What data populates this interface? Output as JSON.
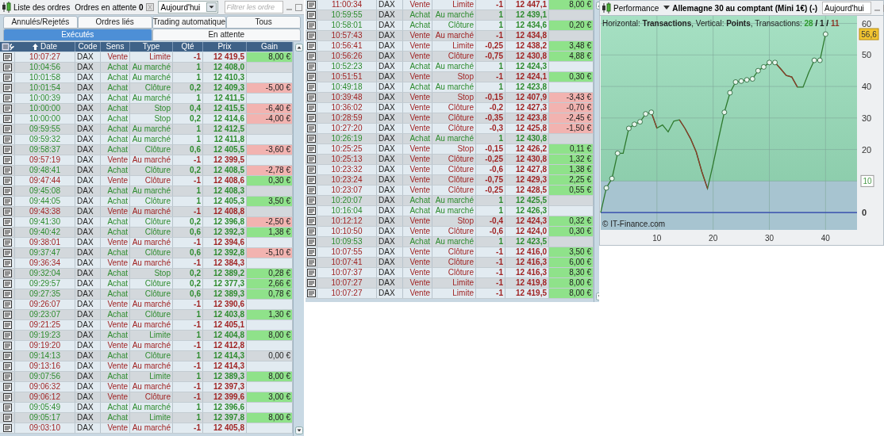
{
  "orders_panel": {
    "title": "Liste des ordres",
    "pending_label": "Ordres en attente",
    "pending_count": "0",
    "period": "Aujourd'hui",
    "filter": {
      "placeholder": "Filtrer les ordre"
    },
    "tabs_top": [
      {
        "label": "Annulés/Rejetés",
        "selected": false
      },
      {
        "label": "Ordres liés",
        "selected": false
      },
      {
        "label": "Trading automatique",
        "selected": false
      },
      {
        "label": "Tous",
        "selected": false
      }
    ],
    "tabs_bottom": [
      {
        "label": "Exécutés",
        "selected": true
      },
      {
        "label": "En attente",
        "selected": false
      }
    ],
    "columns": [
      "Date",
      "Code",
      "Sens",
      "Type",
      "Qté",
      "Prix",
      "Gain"
    ],
    "rows": [
      {
        "time": "10:07:27",
        "code": "DAX",
        "sens": "Vente",
        "type": "Limite",
        "qty": "-1",
        "price": "12 419,5",
        "gain": {
          "text": "8,00 €",
          "color": "#8fe28a"
        },
        "kind": "sell"
      },
      {
        "time": "10:04:56",
        "code": "DAX",
        "sens": "Achat",
        "type": "Au marché",
        "qty": "1",
        "price": "12 408,0",
        "kind": "buy"
      },
      {
        "time": "10:01:58",
        "code": "DAX",
        "sens": "Achat",
        "type": "Au marché",
        "qty": "1",
        "price": "12 410,3",
        "kind": "buy"
      },
      {
        "time": "10:01:54",
        "code": "DAX",
        "sens": "Achat",
        "type": "Clôture",
        "qty": "0,2",
        "price": "12 409,3",
        "gain": {
          "text": "-5,00 €",
          "color": "#f2b3b0"
        },
        "kind": "buy"
      },
      {
        "time": "10:00:39",
        "code": "DAX",
        "sens": "Achat",
        "type": "Au marché",
        "qty": "1",
        "price": "12 411,5",
        "kind": "buy"
      },
      {
        "time": "10:00:00",
        "code": "DAX",
        "sens": "Achat",
        "type": "Stop",
        "qty": "0,4",
        "price": "12 415,5",
        "gain": {
          "text": "-6,40 €",
          "color": "#f2b3b0"
        },
        "kind": "buy"
      },
      {
        "time": "10:00:00",
        "code": "DAX",
        "sens": "Achat",
        "type": "Stop",
        "qty": "0,2",
        "price": "12 414,6",
        "gain": {
          "text": "-4,00 €",
          "color": "#f2b3b0"
        },
        "kind": "buy"
      },
      {
        "time": "09:59:55",
        "code": "DAX",
        "sens": "Achat",
        "type": "Au marché",
        "qty": "1",
        "price": "12 412,5",
        "kind": "buy"
      },
      {
        "time": "09:59:32",
        "code": "DAX",
        "sens": "Achat",
        "type": "Au marché",
        "qty": "1",
        "price": "12 411,8",
        "kind": "buy"
      },
      {
        "time": "09:58:37",
        "code": "DAX",
        "sens": "Achat",
        "type": "Clôture",
        "qty": "0,6",
        "price": "12 405,5",
        "gain": {
          "text": "-3,60 €",
          "color": "#f2b3b0"
        },
        "kind": "buy"
      },
      {
        "time": "09:57:19",
        "code": "DAX",
        "sens": "Vente",
        "type": "Au marché",
        "qty": "-1",
        "price": "12 399,5",
        "kind": "sell"
      },
      {
        "time": "09:48:41",
        "code": "DAX",
        "sens": "Achat",
        "type": "Clôture",
        "qty": "0,2",
        "price": "12 408,5",
        "gain": {
          "text": "-2,78 €",
          "color": "#f2b3b0"
        },
        "kind": "buy"
      },
      {
        "time": "09:47:44",
        "code": "DAX",
        "sens": "Vente",
        "type": "Clôture",
        "qty": "-1",
        "price": "12 408,6",
        "gain": {
          "text": "0,30 €",
          "color": "#8fe28a"
        },
        "kind": "sell"
      },
      {
        "time": "09:45:08",
        "code": "DAX",
        "sens": "Achat",
        "type": "Au marché",
        "qty": "1",
        "price": "12 408,3",
        "kind": "buy"
      },
      {
        "time": "09:44:05",
        "code": "DAX",
        "sens": "Achat",
        "type": "Clôture",
        "qty": "1",
        "price": "12 405,3",
        "gain": {
          "text": "3,50 €",
          "color": "#8fe28a"
        },
        "kind": "buy"
      },
      {
        "time": "09:43:38",
        "code": "DAX",
        "sens": "Vente",
        "type": "Au marché",
        "qty": "-1",
        "price": "12 408,8",
        "kind": "sell"
      },
      {
        "time": "09:41:30",
        "code": "DAX",
        "sens": "Achat",
        "type": "Clôture",
        "qty": "0,2",
        "price": "12 396,8",
        "gain": {
          "text": "-2,50 €",
          "color": "#f2b3b0"
        },
        "kind": "buy"
      },
      {
        "time": "09:40:42",
        "code": "DAX",
        "sens": "Achat",
        "type": "Clôture",
        "qty": "0,6",
        "price": "12 392,3",
        "gain": {
          "text": "1,38 €",
          "color": "#8fe28a"
        },
        "kind": "buy"
      },
      {
        "time": "09:38:01",
        "code": "DAX",
        "sens": "Vente",
        "type": "Au marché",
        "qty": "-1",
        "price": "12 394,6",
        "kind": "sell"
      },
      {
        "time": "09:37:47",
        "code": "DAX",
        "sens": "Achat",
        "type": "Clôture",
        "qty": "0,6",
        "price": "12 392,8",
        "gain": {
          "text": "-5,10 €",
          "color": "#f2b3b0"
        },
        "kind": "buy"
      },
      {
        "time": "09:36:34",
        "code": "DAX",
        "sens": "Vente",
        "type": "Au marché",
        "qty": "-1",
        "price": "12 384,3",
        "kind": "sell"
      },
      {
        "time": "09:32:04",
        "code": "DAX",
        "sens": "Achat",
        "type": "Stop",
        "qty": "0,2",
        "price": "12 389,2",
        "gain": {
          "text": "0,28 €",
          "color": "#8fe28a"
        },
        "kind": "buy"
      },
      {
        "time": "09:29:57",
        "code": "DAX",
        "sens": "Achat",
        "type": "Clôture",
        "qty": "0,2",
        "price": "12 377,3",
        "gain": {
          "text": "2,66 €",
          "color": "#8fe28a"
        },
        "kind": "buy"
      },
      {
        "time": "09:27:35",
        "code": "DAX",
        "sens": "Achat",
        "type": "Clôture",
        "qty": "0,6",
        "price": "12 389,3",
        "gain": {
          "text": "0,78 €",
          "color": "#8fe28a"
        },
        "kind": "buy"
      },
      {
        "time": "09:26:07",
        "code": "DAX",
        "sens": "Vente",
        "type": "Au marché",
        "qty": "-1",
        "price": "12 390,6",
        "kind": "sell"
      },
      {
        "time": "09:23:07",
        "code": "DAX",
        "sens": "Achat",
        "type": "Clôture",
        "qty": "1",
        "price": "12 403,8",
        "gain": {
          "text": "1,30 €",
          "color": "#8fe28a"
        },
        "kind": "buy"
      },
      {
        "time": "09:21:25",
        "code": "DAX",
        "sens": "Vente",
        "type": "Au marché",
        "qty": "-1",
        "price": "12 405,1",
        "kind": "sell"
      },
      {
        "time": "09:19:23",
        "code": "DAX",
        "sens": "Achat",
        "type": "Limite",
        "qty": "1",
        "price": "12 404,8",
        "gain": {
          "text": "8,00 €",
          "color": "#8fe28a"
        },
        "kind": "buy"
      },
      {
        "time": "09:19:20",
        "code": "DAX",
        "sens": "Vente",
        "type": "Au marché",
        "qty": "-1",
        "price": "12 412,8",
        "kind": "sell"
      },
      {
        "time": "09:14:13",
        "code": "DAX",
        "sens": "Achat",
        "type": "Clôture",
        "qty": "1",
        "price": "12 414,3",
        "gain": {
          "text": "0,00 €"
        },
        "kind": "buy"
      },
      {
        "time": "09:13:16",
        "code": "DAX",
        "sens": "Vente",
        "type": "Au marché",
        "qty": "-1",
        "price": "12 414,3",
        "kind": "sell"
      },
      {
        "time": "09:07:56",
        "code": "DAX",
        "sens": "Achat",
        "type": "Limite",
        "qty": "1",
        "price": "12 389,3",
        "gain": {
          "text": "8,00 €",
          "color": "#8fe28a"
        },
        "kind": "buy"
      },
      {
        "time": "09:06:32",
        "code": "DAX",
        "sens": "Vente",
        "type": "Au marché",
        "qty": "-1",
        "price": "12 397,3",
        "kind": "sell"
      },
      {
        "time": "09:06:12",
        "code": "DAX",
        "sens": "Vente",
        "type": "Clôture",
        "qty": "-1",
        "price": "12 399,6",
        "gain": {
          "text": "3,00 €",
          "color": "#8fe28a"
        },
        "kind": "sell"
      },
      {
        "time": "09:05:49",
        "code": "DAX",
        "sens": "Achat",
        "type": "Au marché",
        "qty": "1",
        "price": "12 396,6",
        "kind": "buy"
      },
      {
        "time": "09:05:17",
        "code": "DAX",
        "sens": "Achat",
        "type": "Limite",
        "qty": "1",
        "price": "12 397,8",
        "gain": {
          "text": "8,00 €",
          "color": "#8fe28a"
        },
        "kind": "buy"
      },
      {
        "time": "09:03:10",
        "code": "DAX",
        "sens": "Vente",
        "type": "Au marché",
        "qty": "-1",
        "price": "12 405,8",
        "kind": "sell"
      }
    ]
  },
  "orders_panel_2": {
    "rows": [
      {
        "time": "11:00:34",
        "code": "DAX",
        "sens": "Vente",
        "type": "Limite",
        "qty": "-1",
        "price": "12 447,1",
        "gain": {
          "text": "8,00 €",
          "color": "#8fe28a"
        },
        "kind": "sell"
      },
      {
        "time": "10:59:55",
        "code": "DAX",
        "sens": "Achat",
        "type": "Au marché",
        "qty": "1",
        "price": "12 439,1",
        "kind": "buy"
      },
      {
        "time": "10:58:01",
        "code": "DAX",
        "sens": "Achat",
        "type": "Clôture",
        "qty": "1",
        "price": "12 434,6",
        "gain": {
          "text": "0,20 €",
          "color": "#8fe28a"
        },
        "kind": "buy"
      },
      {
        "time": "10:57:43",
        "code": "DAX",
        "sens": "Vente",
        "type": "Au marché",
        "qty": "-1",
        "price": "12 434,8",
        "kind": "sell"
      },
      {
        "time": "10:56:41",
        "code": "DAX",
        "sens": "Vente",
        "type": "Limite",
        "qty": "-0,25",
        "price": "12 438,2",
        "gain": {
          "text": "3,48 €",
          "color": "#8fe28a"
        },
        "kind": "sell"
      },
      {
        "time": "10:56:26",
        "code": "DAX",
        "sens": "Vente",
        "type": "Clôture",
        "qty": "-0,75",
        "price": "12 430,8",
        "gain": {
          "text": "4,88 €",
          "color": "#8fe28a"
        },
        "kind": "sell"
      },
      {
        "time": "10:52:23",
        "code": "DAX",
        "sens": "Achat",
        "type": "Au marché",
        "qty": "1",
        "price": "12 424,3",
        "kind": "buy"
      },
      {
        "time": "10:51:51",
        "code": "DAX",
        "sens": "Vente",
        "type": "Stop",
        "qty": "-1",
        "price": "12 424,1",
        "gain": {
          "text": "0,30 €",
          "color": "#8fe28a"
        },
        "kind": "sell"
      },
      {
        "time": "10:49:18",
        "code": "DAX",
        "sens": "Achat",
        "type": "Au marché",
        "qty": "1",
        "price": "12 423,8",
        "kind": "buy"
      },
      {
        "time": "10:39:48",
        "code": "DAX",
        "sens": "Vente",
        "type": "Stop",
        "qty": "-0,15",
        "price": "12 407,9",
        "gain": {
          "text": "-3,43 €",
          "color": "#f2b3b0"
        },
        "kind": "sell"
      },
      {
        "time": "10:36:02",
        "code": "DAX",
        "sens": "Vente",
        "type": "Clôture",
        "qty": "-0,2",
        "price": "12 427,3",
        "gain": {
          "text": "-0,70 €",
          "color": "#f2b3b0"
        },
        "kind": "sell"
      },
      {
        "time": "10:28:59",
        "code": "DAX",
        "sens": "Vente",
        "type": "Clôture",
        "qty": "-0,35",
        "price": "12 423,8",
        "gain": {
          "text": "-2,45 €",
          "color": "#f2b3b0"
        },
        "kind": "sell"
      },
      {
        "time": "10:27:20",
        "code": "DAX",
        "sens": "Vente",
        "type": "Clôture",
        "qty": "-0,3",
        "price": "12 425,8",
        "gain": {
          "text": "-1,50 €",
          "color": "#f2b3b0"
        },
        "kind": "sell"
      },
      {
        "time": "10:26:19",
        "code": "DAX",
        "sens": "Achat",
        "type": "Au marché",
        "qty": "1",
        "price": "12 430,8",
        "kind": "buy"
      },
      {
        "time": "10:25:25",
        "code": "DAX",
        "sens": "Vente",
        "type": "Stop",
        "qty": "-0,15",
        "price": "12 426,2",
        "gain": {
          "text": "0,11 €",
          "color": "#8fe28a"
        },
        "kind": "sell"
      },
      {
        "time": "10:25:13",
        "code": "DAX",
        "sens": "Vente",
        "type": "Clôture",
        "qty": "-0,25",
        "price": "12 430,8",
        "gain": {
          "text": "1,32 €",
          "color": "#8fe28a"
        },
        "kind": "sell"
      },
      {
        "time": "10:23:32",
        "code": "DAX",
        "sens": "Vente",
        "type": "Clôture",
        "qty": "-0,6",
        "price": "12 427,8",
        "gain": {
          "text": "1,38 €",
          "color": "#8fe28a"
        },
        "kind": "sell"
      },
      {
        "time": "10:23:24",
        "code": "DAX",
        "sens": "Vente",
        "type": "Clôture",
        "qty": "-0,75",
        "price": "12 429,3",
        "gain": {
          "text": "2,25 €",
          "color": "#8fe28a"
        },
        "kind": "sell"
      },
      {
        "time": "10:23:07",
        "code": "DAX",
        "sens": "Vente",
        "type": "Clôture",
        "qty": "-0,25",
        "price": "12 428,5",
        "gain": {
          "text": "0,55 €",
          "color": "#8fe28a"
        },
        "kind": "sell"
      },
      {
        "time": "10:20:07",
        "code": "DAX",
        "sens": "Achat",
        "type": "Au marché",
        "qty": "1",
        "price": "12 425,5",
        "kind": "buy"
      },
      {
        "time": "10:16:04",
        "code": "DAX",
        "sens": "Achat",
        "type": "Au marché",
        "qty": "1",
        "price": "12 426,3",
        "kind": "buy"
      },
      {
        "time": "10:12:12",
        "code": "DAX",
        "sens": "Vente",
        "type": "Stop",
        "qty": "-0,4",
        "price": "12 424,3",
        "gain": {
          "text": "0,32 €",
          "color": "#8fe28a"
        },
        "kind": "sell"
      },
      {
        "time": "10:10:50",
        "code": "DAX",
        "sens": "Vente",
        "type": "Clôture",
        "qty": "-0,6",
        "price": "12 424,0",
        "gain": {
          "text": "0,30 €",
          "color": "#8fe28a"
        },
        "kind": "sell"
      },
      {
        "time": "10:09:53",
        "code": "DAX",
        "sens": "Achat",
        "type": "Au marché",
        "qty": "1",
        "price": "12 423,5",
        "kind": "buy"
      },
      {
        "time": "10:07:55",
        "code": "DAX",
        "sens": "Vente",
        "type": "Clôture",
        "qty": "-1",
        "price": "12 416,0",
        "gain": {
          "text": "3,50 €",
          "color": "#8fe28a"
        },
        "kind": "sell"
      },
      {
        "time": "10:07:41",
        "code": "DAX",
        "sens": "Vente",
        "type": "Clôture",
        "qty": "-1",
        "price": "12 416,3",
        "gain": {
          "text": "6,00 €",
          "color": "#8fe28a"
        },
        "kind": "sell"
      },
      {
        "time": "10:07:37",
        "code": "DAX",
        "sens": "Vente",
        "type": "Clôture",
        "qty": "-1",
        "price": "12 416,3",
        "gain": {
          "text": "8,30 €",
          "color": "#8fe28a"
        },
        "kind": "sell"
      },
      {
        "time": "10:07:27",
        "code": "DAX",
        "sens": "Vente",
        "type": "Limite",
        "qty": "-1",
        "price": "12 419,8",
        "gain": {
          "text": "8,00 €",
          "color": "#8fe28a"
        },
        "kind": "sell"
      },
      {
        "time": "10:07:27",
        "code": "DAX",
        "sens": "Vente",
        "type": "Limite",
        "qty": "-1",
        "price": "12 419,5",
        "gain": {
          "text": "8,00 €",
          "color": "#8fe28a"
        },
        "kind": "sell"
      }
    ]
  },
  "performance_panel": {
    "title": "Performance",
    "instrument": "Allemagne 30 au comptant (Mini 1€) (-)",
    "period": "Aujourd'hui",
    "subtitle": "Horizontal: **Transactions**, Vertical: **Points**, Transactions: ",
    "counts": [
      {
        "value": "28",
        "color": "#2e9a2e"
      },
      {
        "value": "1",
        "color": "#222222"
      },
      {
        "value": "11",
        "color": "#8b3a2a"
      }
    ],
    "count_separator": " / ",
    "chart_data": {
      "type": "line",
      "grid": true,
      "xlim": [
        0,
        45.6
      ],
      "ylim": [
        -5.5,
        62.4
      ],
      "xticks": [
        10,
        20,
        30,
        40
      ],
      "yticks": [
        0,
        10,
        20,
        30,
        40,
        50,
        60
      ],
      "x": [
        0,
        1,
        2,
        3,
        4,
        5,
        6,
        7,
        8,
        9,
        10,
        11,
        12,
        13,
        14,
        15,
        16,
        17,
        18,
        19,
        20,
        21,
        22,
        23,
        24,
        25,
        26,
        27,
        28,
        29,
        30,
        31,
        32,
        33,
        34,
        35,
        36,
        37,
        38,
        39,
        40
      ],
      "series": [
        {
          "color": "#2f7a2f",
          "values": [
            0,
            7.8,
            10.8,
            18.8,
            18.8,
            26.7,
            28,
            28.8,
            31.3,
            31.8,
            26.8,
            27.8,
            25.6,
            29,
            29.4,
            26.7,
            23.4,
            19.2,
            12.9,
            7.6,
            15.4,
            23.8,
            31.8,
            38,
            41.4,
            41.7,
            42.1,
            42.4,
            45,
            46.2,
            47.6,
            47.6,
            45.6,
            43.5,
            43,
            39.8,
            39.8,
            44.4,
            48.3,
            48.3,
            56.6
          ]
        },
        {
          "color": "#8b3a2a",
          "values": [
            null,
            null,
            null,
            null,
            null,
            null,
            null,
            null,
            null,
            31.8,
            26.8,
            null,
            null,
            null,
            29.4,
            26.7,
            23.4,
            19.2,
            12.9,
            7.6,
            null,
            null,
            null,
            null,
            null,
            null,
            null,
            null,
            null,
            null,
            null,
            47.6,
            45.6,
            43.5,
            43,
            39.8,
            null,
            null,
            null,
            null,
            null
          ]
        }
      ],
      "ref_lines": [
        {
          "axis": "y",
          "value": 0,
          "color": "#2b3fb0"
        }
      ],
      "annotations": [
        "56,6",
        "© IT-Finance.com"
      ]
    }
  }
}
